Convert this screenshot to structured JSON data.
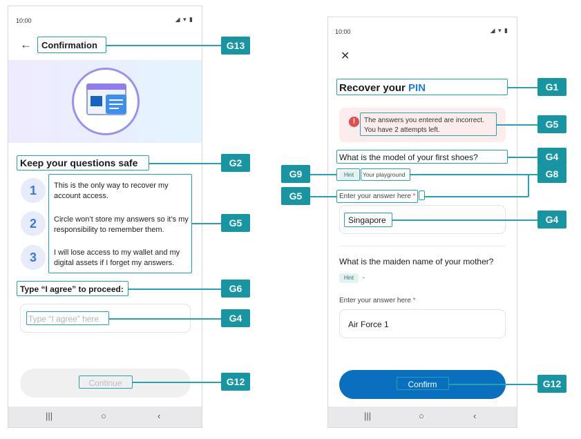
{
  "left": {
    "status_time": "10:00",
    "status_icons": "◢ ▾ ▮",
    "back_icon": "←",
    "title": "Confirmation",
    "heading": "Keep your questions safe",
    "items": [
      {
        "num": "1",
        "text": "This is the only way to recover my account access."
      },
      {
        "num": "2",
        "text": "Circle won’t store my answers so it’s my responsibility to remember them."
      },
      {
        "num": "3",
        "text": "I will lose access to my wallet and my digital assets if I forget my answers."
      }
    ],
    "agree_label": "Type “I agree” to proceed:",
    "agree_placeholder": "Type “I agree” here",
    "continue_label": "Continue",
    "nav": [
      "|||",
      "○",
      "‹"
    ]
  },
  "right": {
    "status_time": "10:00",
    "status_icons": "◢ ▾ ▮",
    "close_icon": "✕",
    "title_prefix": "Recover your",
    "title_accent": "PIN",
    "error_line1": "The answers you entered are incorrect.",
    "error_line2": "You have 2 attempts left.",
    "q1": "What is the model of your first shoes?",
    "hint_label": "Hint",
    "q1_hint": "Your playground",
    "answer_label": "Enter your answer here",
    "required_mark": "*",
    "q1_answer": "Singapore",
    "q2": "What is the maiden name of your mother?",
    "q2_hint": "-",
    "q2_answer": "Air Force 1",
    "confirm_label": "Confirm",
    "nav": [
      "|||",
      "○",
      "‹"
    ]
  },
  "tags": {
    "g13": "G13",
    "g2": "G2",
    "g5a": "G5",
    "g6": "G6",
    "g4a": "G4",
    "g12a": "G12",
    "g1": "G1",
    "g5b": "G5",
    "g4b": "G4",
    "g9": "G9",
    "g8": "G8",
    "g5c": "G5",
    "g4c": "G4",
    "g12b": "G12"
  },
  "colors": {
    "accent": "#1795a3",
    "primary_button": "#0b6fc0",
    "error_bg": "#fdecec",
    "error_icon": "#e24c4b",
    "pin_blue": "#1a7fd4"
  }
}
